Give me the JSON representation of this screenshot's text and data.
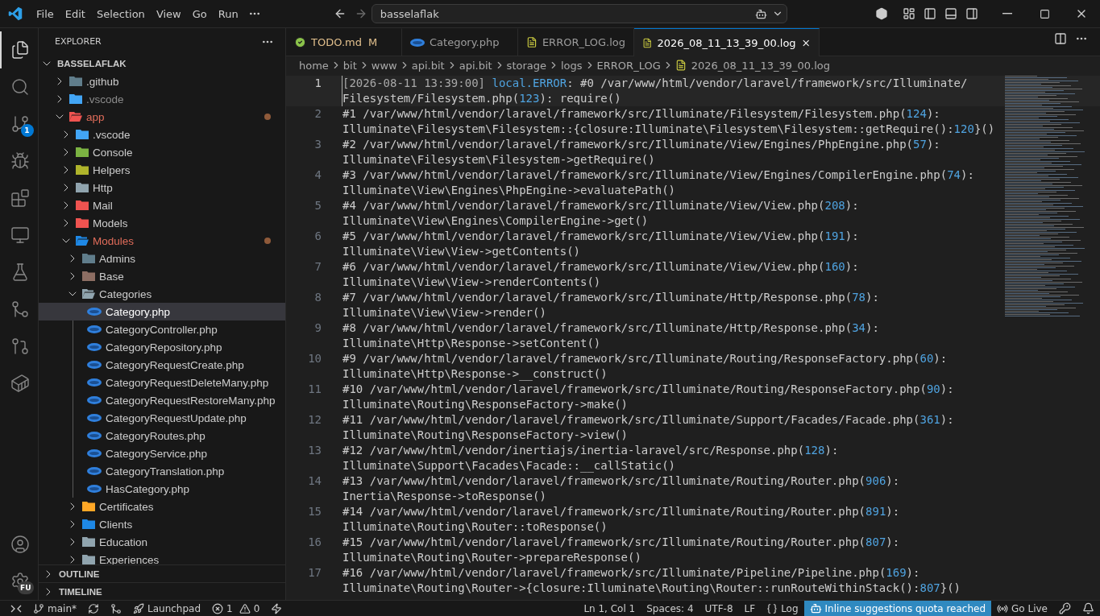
{
  "title_bar": {
    "menu": [
      "File",
      "Edit",
      "Selection",
      "View",
      "Go",
      "Run"
    ],
    "command_center": {
      "text": "basselaflak"
    }
  },
  "activity_bar": {
    "items": [
      {
        "kind": "explorer",
        "selected": true
      },
      {
        "kind": "search",
        "selected": false
      },
      {
        "kind": "source-control",
        "selected": false,
        "badge": "1"
      },
      {
        "kind": "debug",
        "selected": false
      },
      {
        "kind": "extensions",
        "selected": false
      },
      {
        "kind": "remote",
        "selected": false
      },
      {
        "kind": "testing",
        "selected": false
      },
      {
        "kind": "graph",
        "selected": false
      },
      {
        "kind": "gitlens",
        "selected": false
      },
      {
        "kind": "containers",
        "selected": false
      }
    ],
    "bottom": [
      {
        "kind": "account"
      },
      {
        "kind": "settings",
        "badge": "FU"
      }
    ]
  },
  "sidebar": {
    "title": "EXPLORER",
    "root": {
      "label": "BASSELAFLAK",
      "expanded": true
    },
    "tree": [
      {
        "kind": "folder",
        "label": ".github",
        "color": "#607d8b",
        "expanded": false,
        "modified": false,
        "dimmed": false,
        "selected": false
      },
      {
        "kind": "folder",
        "label": ".vscode",
        "color": "#42a5f5",
        "expanded": false,
        "modified": false,
        "dimmed": true,
        "selected": false
      },
      {
        "kind": "folder",
        "label": "app",
        "color": "#ef5350",
        "expanded": true,
        "modified": true,
        "dimmed": false,
        "selected": false,
        "children": [
          {
            "kind": "folder",
            "label": ".vscode",
            "color": "#42a5f5",
            "expanded": false,
            "modified": false,
            "dimmed": false,
            "selected": false
          },
          {
            "kind": "folder",
            "label": "Console",
            "color": "#7cb342",
            "expanded": false,
            "modified": false,
            "dimmed": false,
            "selected": false
          },
          {
            "kind": "folder",
            "label": "Helpers",
            "color": "#afb42b",
            "expanded": false,
            "modified": false,
            "dimmed": false,
            "selected": false
          },
          {
            "kind": "folder",
            "label": "Http",
            "color": "#90a4ae",
            "expanded": false,
            "modified": false,
            "dimmed": false,
            "selected": false
          },
          {
            "kind": "folder",
            "label": "Mail",
            "color": "#ef5350",
            "expanded": false,
            "modified": false,
            "dimmed": false,
            "selected": false
          },
          {
            "kind": "folder",
            "label": "Models",
            "color": "#ef5350",
            "expanded": false,
            "modified": false,
            "dimmed": false,
            "selected": false
          },
          {
            "kind": "folder",
            "label": "Modules",
            "color": "#1e88e5",
            "expanded": true,
            "modified": true,
            "dimmed": false,
            "selected": false,
            "children": [
              {
                "kind": "folder",
                "label": "Admins",
                "color": "#607d8b",
                "expanded": false,
                "modified": false,
                "dimmed": false,
                "selected": false
              },
              {
                "kind": "folder",
                "label": "Base",
                "color": "#8d6e63",
                "expanded": false,
                "modified": false,
                "dimmed": false,
                "selected": false
              },
              {
                "kind": "folder",
                "label": "Categories",
                "color": "#90a4ae",
                "expanded": true,
                "modified": false,
                "dimmed": false,
                "selected": false,
                "children": [
                  {
                    "kind": "file",
                    "label": "Category.php",
                    "modified": false,
                    "dimmed": false,
                    "selected": true
                  },
                  {
                    "kind": "file",
                    "label": "CategoryController.php",
                    "modified": false,
                    "dimmed": false,
                    "selected": false
                  },
                  {
                    "kind": "file",
                    "label": "CategoryRepository.php",
                    "modified": false,
                    "dimmed": false,
                    "selected": false
                  },
                  {
                    "kind": "file",
                    "label": "CategoryRequestCreate.php",
                    "modified": false,
                    "dimmed": false,
                    "selected": false
                  },
                  {
                    "kind": "file",
                    "label": "CategoryRequestDeleteMany.php",
                    "modified": false,
                    "dimmed": false,
                    "selected": false
                  },
                  {
                    "kind": "file",
                    "label": "CategoryRequestRestoreMany.php",
                    "modified": false,
                    "dimmed": false,
                    "selected": false
                  },
                  {
                    "kind": "file",
                    "label": "CategoryRequestUpdate.php",
                    "modified": false,
                    "dimmed": false,
                    "selected": false
                  },
                  {
                    "kind": "file",
                    "label": "CategoryRoutes.php",
                    "modified": false,
                    "dimmed": false,
                    "selected": false
                  },
                  {
                    "kind": "file",
                    "label": "CategoryService.php",
                    "modified": false,
                    "dimmed": false,
                    "selected": false
                  },
                  {
                    "kind": "file",
                    "label": "CategoryTranslation.php",
                    "modified": false,
                    "dimmed": false,
                    "selected": false
                  },
                  {
                    "kind": "file",
                    "label": "HasCategory.php",
                    "modified": false,
                    "dimmed": false,
                    "selected": false
                  }
                ]
              },
              {
                "kind": "folder",
                "label": "Certificates",
                "color": "#ffa726",
                "expanded": false,
                "modified": false,
                "dimmed": false,
                "selected": false
              },
              {
                "kind": "folder",
                "label": "Clients",
                "color": "#1e88e5",
                "expanded": false,
                "modified": false,
                "dimmed": false,
                "selected": false
              },
              {
                "kind": "folder",
                "label": "Education",
                "color": "#90a4ae",
                "expanded": false,
                "modified": false,
                "dimmed": false,
                "selected": false
              },
              {
                "kind": "folder",
                "label": "Experiences",
                "color": "#90a4ae",
                "expanded": false,
                "modified": false,
                "dimmed": false,
                "selected": false
              }
            ]
          }
        ]
      }
    ],
    "sections": [
      {
        "label": "OUTLINE",
        "expanded": false
      },
      {
        "label": "TIMELINE",
        "expanded": false
      }
    ]
  },
  "tabs": [
    {
      "label": "TODO.md",
      "kind": "todo",
      "badge": "M",
      "modified": true,
      "selected": false
    },
    {
      "label": "Category.php",
      "kind": "php",
      "modified": false,
      "selected": false
    },
    {
      "label": "ERROR_LOG.log",
      "kind": "log",
      "modified": false,
      "selected": false
    },
    {
      "label": "2026_08_11_13_39_00.log",
      "kind": "log",
      "modified": false,
      "selected": true
    }
  ],
  "breadcrumb": [
    "home",
    "bit",
    "www",
    "api.bit",
    "api.bit",
    "storage",
    "logs",
    "ERROR_LOG",
    "2026_08_11_13_39_00.log"
  ],
  "editor": {
    "lines": [
      {
        "number": "1",
        "current": true,
        "rows": [
          "[2026-08-11 13:39:00] local.ERROR: #0 /var/www/html/vendor/laravel/framework/src/Illuminate/",
          "Filesystem/Filesystem.php(123): require()"
        ]
      },
      {
        "number": "2",
        "current": false,
        "rows": [
          "#1 /var/www/html/vendor/laravel/framework/src/Illuminate/Filesystem/Filesystem.php(124):",
          "Illuminate\\Filesystem\\Filesystem::{closure:Illuminate\\Filesystem\\Filesystem::getRequire():120}()"
        ]
      },
      {
        "number": "3",
        "current": false,
        "rows": [
          "#2 /var/www/html/vendor/laravel/framework/src/Illuminate/View/Engines/PhpEngine.php(57):",
          "Illuminate\\Filesystem\\Filesystem->getRequire()"
        ]
      },
      {
        "number": "4",
        "current": false,
        "rows": [
          "#3 /var/www/html/vendor/laravel/framework/src/Illuminate/View/Engines/CompilerEngine.php(74):",
          "Illuminate\\View\\Engines\\PhpEngine->evaluatePath()"
        ]
      },
      {
        "number": "5",
        "current": false,
        "rows": [
          "#4 /var/www/html/vendor/laravel/framework/src/Illuminate/View/View.php(208):",
          "Illuminate\\View\\Engines\\CompilerEngine->get()"
        ]
      },
      {
        "number": "6",
        "current": false,
        "rows": [
          "#5 /var/www/html/vendor/laravel/framework/src/Illuminate/View/View.php(191):",
          "Illuminate\\View\\View->getContents()"
        ]
      },
      {
        "number": "7",
        "current": false,
        "rows": [
          "#6 /var/www/html/vendor/laravel/framework/src/Illuminate/View/View.php(160):",
          "Illuminate\\View\\View->renderContents()"
        ]
      },
      {
        "number": "8",
        "current": false,
        "rows": [
          "#7 /var/www/html/vendor/laravel/framework/src/Illuminate/Http/Response.php(78):",
          "Illuminate\\View\\View->render()"
        ]
      },
      {
        "number": "9",
        "current": false,
        "rows": [
          "#8 /var/www/html/vendor/laravel/framework/src/Illuminate/Http/Response.php(34):",
          "Illuminate\\Http\\Response->setContent()"
        ]
      },
      {
        "number": "10",
        "current": false,
        "rows": [
          "#9 /var/www/html/vendor/laravel/framework/src/Illuminate/Routing/ResponseFactory.php(60):",
          "Illuminate\\Http\\Response->__construct()"
        ]
      },
      {
        "number": "11",
        "current": false,
        "rows": [
          "#10 /var/www/html/vendor/laravel/framework/src/Illuminate/Routing/ResponseFactory.php(90):",
          "Illuminate\\Routing\\ResponseFactory->make()"
        ]
      },
      {
        "number": "12",
        "current": false,
        "rows": [
          "#11 /var/www/html/vendor/laravel/framework/src/Illuminate/Support/Facades/Facade.php(361):",
          "Illuminate\\Routing\\ResponseFactory->view()"
        ]
      },
      {
        "number": "13",
        "current": false,
        "rows": [
          "#12 /var/www/html/vendor/inertiajs/inertia-laravel/src/Response.php(128):",
          "Illuminate\\Support\\Facades\\Facade::__callStatic()"
        ]
      },
      {
        "number": "14",
        "current": false,
        "rows": [
          "#13 /var/www/html/vendor/laravel/framework/src/Illuminate/Routing/Router.php(906):",
          "Inertia\\Response->toResponse()"
        ]
      },
      {
        "number": "15",
        "current": false,
        "rows": [
          "#14 /var/www/html/vendor/laravel/framework/src/Illuminate/Routing/Router.php(891):",
          "Illuminate\\Routing\\Router::toResponse()"
        ]
      },
      {
        "number": "16",
        "current": false,
        "rows": [
          "#15 /var/www/html/vendor/laravel/framework/src/Illuminate/Routing/Router.php(807):",
          "Illuminate\\Routing\\Router->prepareResponse()"
        ]
      },
      {
        "number": "17",
        "current": false,
        "rows": [
          "#16 /var/www/html/vendor/laravel/framework/src/Illuminate/Pipeline/Pipeline.php(169):",
          "Illuminate\\Routing\\Router->{closure:Illuminate\\Routing\\Router::runRouteWithinStack():807}()"
        ]
      }
    ]
  },
  "status_bar": {
    "left": [
      {
        "kind": "remote"
      },
      {
        "kind": "branch",
        "text": "main*"
      },
      {
        "kind": "sync"
      },
      {
        "kind": "graph"
      },
      {
        "kind": "launchpad",
        "text": "Launchpad"
      },
      {
        "kind": "problems",
        "errors": "1",
        "warnings": "0"
      },
      {
        "kind": "lightning"
      }
    ],
    "right": [
      {
        "kind": "text",
        "text": "Ln 1, Col 1"
      },
      {
        "kind": "text",
        "text": "Spaces: 4"
      },
      {
        "kind": "text",
        "text": "UTF-8"
      },
      {
        "kind": "text",
        "text": "LF"
      },
      {
        "kind": "language",
        "text": "Log"
      },
      {
        "kind": "copilot",
        "text": "Inline suggestions quota reached",
        "highlighted": true
      },
      {
        "kind": "live",
        "text": "Go Live"
      },
      {
        "kind": "key"
      },
      {
        "kind": "bell"
      }
    ]
  }
}
